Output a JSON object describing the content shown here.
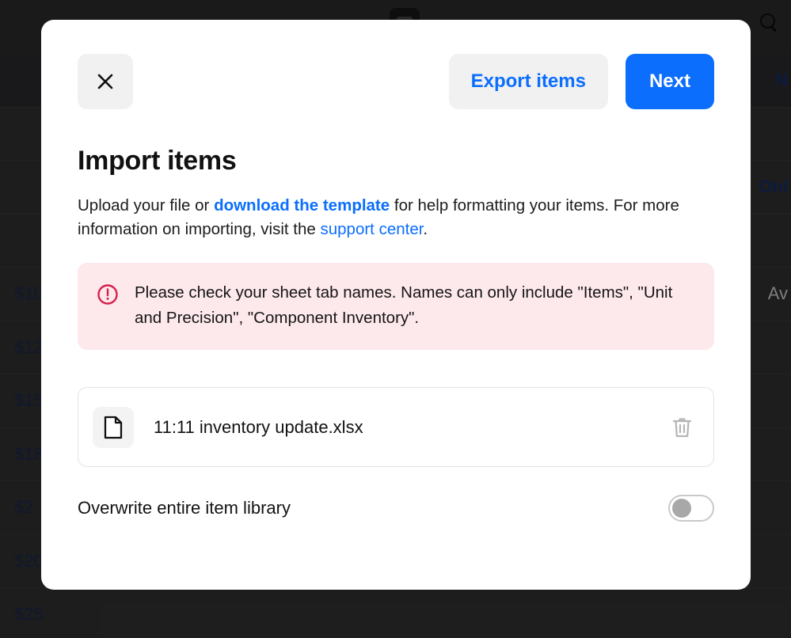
{
  "background": {
    "topbar": {
      "center_icon": "app-logo-icon",
      "search_icon": "search-icon"
    },
    "rows": [
      {
        "price": "",
        "right": "N",
        "right_style": "link",
        "header": true
      },
      {
        "price": "",
        "right": "",
        "right_style": "plain",
        "header": false
      },
      {
        "price": "",
        "right": "Onl",
        "right_style": "link",
        "header": false
      },
      {
        "price": "",
        "right": "",
        "right_style": "plain",
        "header": false
      },
      {
        "price": "$10",
        "right": "Av",
        "right_style": "plain",
        "header": false
      },
      {
        "price": "$12",
        "right": "",
        "right_style": "plain",
        "header": false
      },
      {
        "price": "$15",
        "right": "",
        "right_style": "plain",
        "header": false
      },
      {
        "price": "$18",
        "right": "",
        "right_style": "plain",
        "header": false
      },
      {
        "price": "$2",
        "right": "",
        "right_style": "plain",
        "header": false
      },
      {
        "price": "$20",
        "right": "",
        "right_style": "plain",
        "header": false
      },
      {
        "price": "$25",
        "right": "",
        "right_style": "plain",
        "header": false
      }
    ]
  },
  "modal": {
    "close_icon": "close-icon",
    "export_label": "Export items",
    "next_label": "Next",
    "title": "Import items",
    "description": {
      "part1": "Upload your file or ",
      "link1": "download the template",
      "part2": " for help formatting your items. For more information on importing, visit the ",
      "link2": "support center",
      "part3": "."
    },
    "error": {
      "icon": "error-circle-icon",
      "message": "Please check your sheet tab names. Names can only include \"Items\", \"Unit and Precision\", \"Component Inventory\"."
    },
    "file": {
      "icon": "document-icon",
      "name": "11:11 inventory update.xlsx",
      "delete_icon": "trash-icon"
    },
    "overwrite": {
      "label": "Overwrite entire item library",
      "state": "off"
    }
  },
  "colors": {
    "accent_blue": "#0b6efd",
    "error_bg": "#fde8ec",
    "error_red": "#d6224a",
    "button_gray": "#f1f1f1"
  }
}
